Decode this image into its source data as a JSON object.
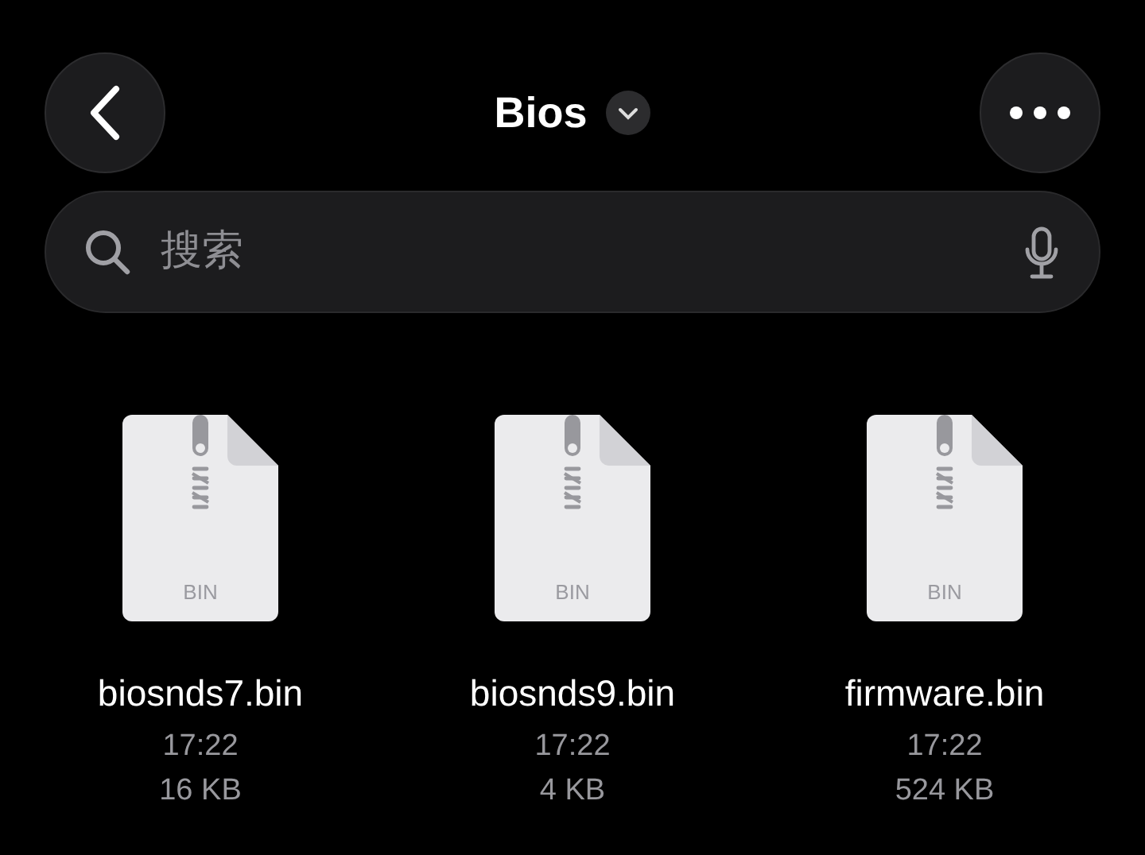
{
  "header": {
    "title": "Bios"
  },
  "search": {
    "placeholder": "搜索"
  },
  "files": [
    {
      "name": "biosnds7.bin",
      "time": "17:22",
      "size": "16 KB",
      "type_label": "BIN"
    },
    {
      "name": "biosnds9.bin",
      "time": "17:22",
      "size": "4 KB",
      "type_label": "BIN"
    },
    {
      "name": "firmware.bin",
      "time": "17:22",
      "size": "524 KB",
      "type_label": "BIN"
    }
  ]
}
